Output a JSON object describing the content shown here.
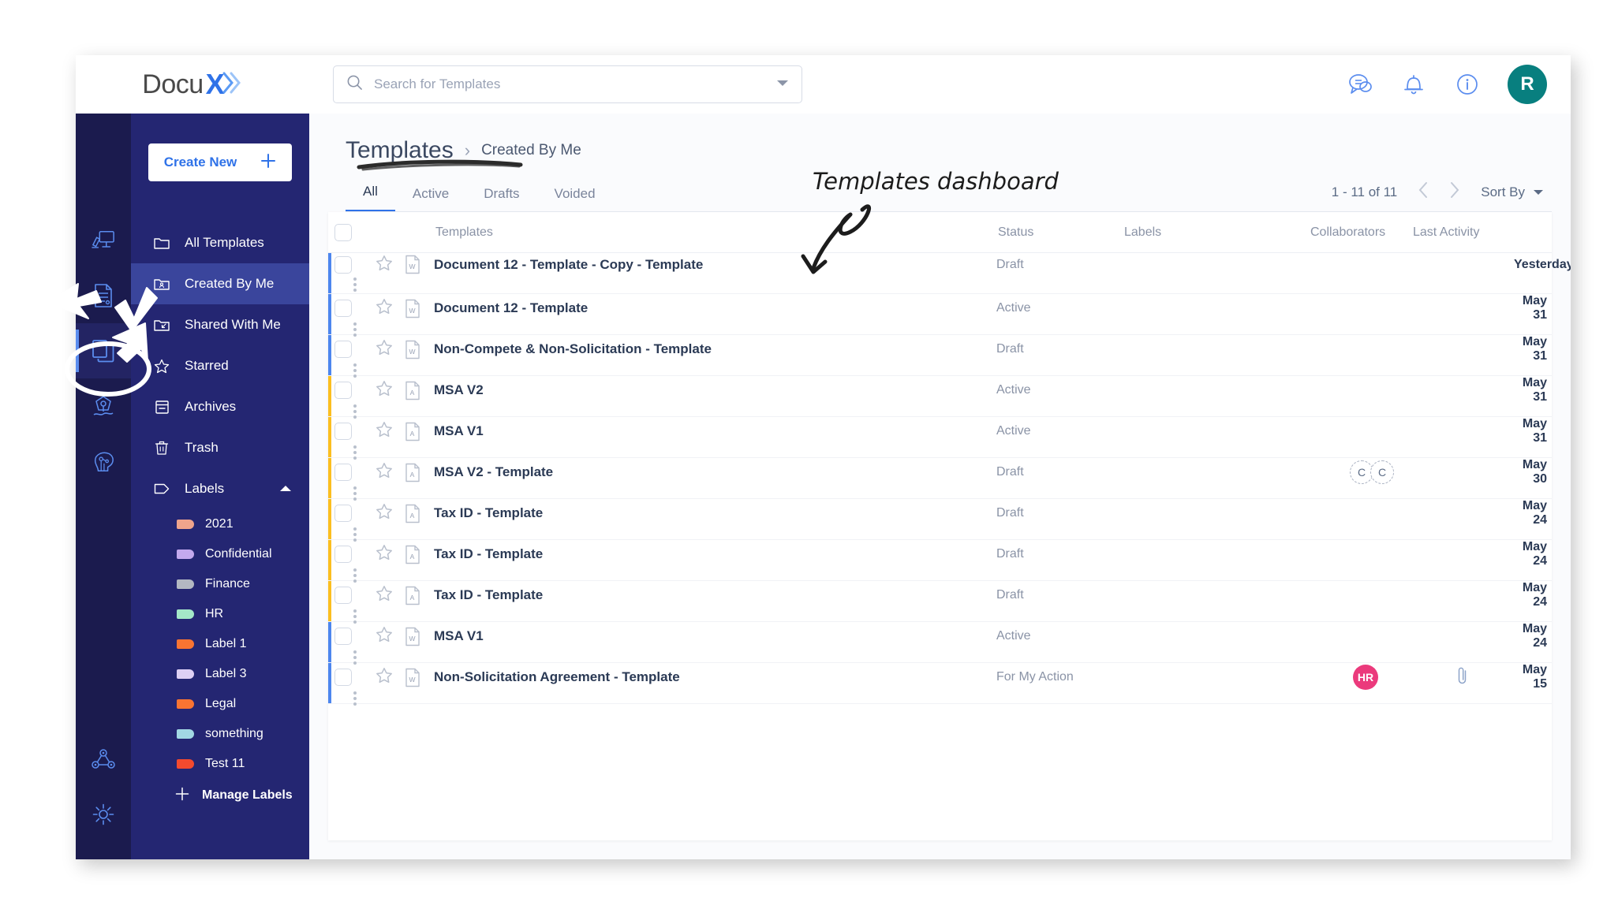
{
  "brand": {
    "name": "Docu",
    "mark": "X"
  },
  "search": {
    "placeholder": "Search for Templates",
    "value": ""
  },
  "topbar": {
    "chat_icon": "chat-bubbles-icon",
    "bell_icon": "notification-bell-icon",
    "info_icon": "info-circle-icon",
    "avatar_initial": "R",
    "avatar_color": "#087f7f"
  },
  "sidebar": {
    "create_new_label": "Create New",
    "rail": [
      {
        "name": "dashboard-icon"
      },
      {
        "name": "documents-icon"
      },
      {
        "name": "templates-icon",
        "active": true
      },
      {
        "name": "signature-pen-icon"
      },
      {
        "name": "ai-brain-icon"
      },
      {
        "name": "workflow-network-icon"
      },
      {
        "name": "settings-gear-icon"
      }
    ],
    "items": [
      {
        "label": "All Templates",
        "icon": "folder-icon",
        "active": false
      },
      {
        "label": "Created By Me",
        "icon": "folder-user-icon",
        "active": true
      },
      {
        "label": "Shared With Me",
        "icon": "folder-shared-icon",
        "active": false
      },
      {
        "label": "Starred",
        "icon": "star-icon",
        "active": false
      },
      {
        "label": "Archives",
        "icon": "archive-icon",
        "active": false
      },
      {
        "label": "Trash",
        "icon": "trash-icon",
        "active": false
      },
      {
        "label": "Labels",
        "icon": "tag-icon",
        "active": false,
        "expanded": true
      }
    ],
    "labels": [
      {
        "label": "2021",
        "color": "#efa48c"
      },
      {
        "label": "Confidential",
        "color": "#c3a9ee"
      },
      {
        "label": "Finance",
        "color": "#b3b8c2"
      },
      {
        "label": "HR",
        "color": "#a4e8c8"
      },
      {
        "label": "Label 1",
        "color": "#f97432"
      },
      {
        "label": "Label 3",
        "color": "#ddd0f4"
      },
      {
        "label": "Legal",
        "color": "#f97432"
      },
      {
        "label": "something",
        "color": "#a2d8e4"
      },
      {
        "label": "Test 11",
        "color": "#f44a2e"
      }
    ],
    "manage_labels_label": "Manage Labels"
  },
  "breadcrumb": {
    "root": "Templates",
    "separator": "›",
    "current": "Created By Me"
  },
  "tabs": [
    {
      "label": "All",
      "active": true
    },
    {
      "label": "Active",
      "active": false
    },
    {
      "label": "Drafts",
      "active": false
    },
    {
      "label": "Voided",
      "active": false
    }
  ],
  "pagination": {
    "range": "1 - 11 of 11",
    "prev_icon": "chevron-left-icon",
    "next_icon": "chevron-right-icon"
  },
  "sort": {
    "label": "Sort By",
    "chevron": "chevron-down-icon"
  },
  "table": {
    "columns": [
      "",
      "",
      "",
      "Templates",
      "Status",
      "Labels",
      "Collaborators",
      "Last Activity",
      ""
    ],
    "headers": {
      "templates": "Templates",
      "status": "Status",
      "labels": "Labels",
      "collaborators": "Collaborators",
      "last_activity": "Last Activity"
    },
    "rows": [
      {
        "name": "Document 12 - Template - Copy - Template",
        "status": "Draft",
        "labels": "",
        "collaborators": [],
        "attachment": false,
        "activity": "Yesterday",
        "accent": "blue",
        "filetype": "word"
      },
      {
        "name": "Document 12 - Template",
        "status": "Active",
        "labels": "",
        "collaborators": [],
        "attachment": false,
        "activity": "May 31",
        "accent": "blue",
        "filetype": "word"
      },
      {
        "name": "Non-Compete & Non-Solicitation - Template",
        "status": "Draft",
        "labels": "",
        "collaborators": [],
        "attachment": false,
        "activity": "May 31",
        "accent": "blue",
        "filetype": "word"
      },
      {
        "name": "MSA V2",
        "status": "Active",
        "labels": "",
        "collaborators": [],
        "attachment": false,
        "activity": "May 31",
        "accent": "amber",
        "filetype": "pdf"
      },
      {
        "name": "MSA V1",
        "status": "Active",
        "labels": "",
        "collaborators": [],
        "attachment": false,
        "activity": "May 31",
        "accent": "amber",
        "filetype": "pdf"
      },
      {
        "name": "MSA V2 - Template",
        "status": "Draft",
        "labels": "",
        "collaborators": [
          "C",
          "C"
        ],
        "attachment": false,
        "activity": "May 30",
        "accent": "amber",
        "filetype": "pdf"
      },
      {
        "name": "Tax ID - Template",
        "status": "Draft",
        "labels": "",
        "collaborators": [],
        "attachment": false,
        "activity": "May 24",
        "accent": "amber",
        "filetype": "pdf"
      },
      {
        "name": "Tax ID - Template",
        "status": "Draft",
        "labels": "",
        "collaborators": [],
        "attachment": false,
        "activity": "May 24",
        "accent": "amber",
        "filetype": "pdf"
      },
      {
        "name": "Tax ID - Template",
        "status": "Draft",
        "labels": "",
        "collaborators": [],
        "attachment": false,
        "activity": "May 24",
        "accent": "amber",
        "filetype": "pdf"
      },
      {
        "name": "MSA V1",
        "status": "Active",
        "labels": "",
        "collaborators": [],
        "attachment": false,
        "activity": "May 24",
        "accent": "blue",
        "filetype": "word"
      },
      {
        "name": "Non-Solicitation Agreement - Template",
        "status": "For My Action",
        "labels": "",
        "collaborators": [
          "HR"
        ],
        "attachment": true,
        "activity": "May 15",
        "accent": "blue",
        "filetype": "word"
      }
    ]
  },
  "annotations": {
    "callout_text": "Templates dashboard",
    "marks": [
      "title-underline-scribble",
      "curved-arrow-to-table",
      "arrows-to-templates-rail-icon",
      "circle-around-templates-rail-icon"
    ]
  }
}
